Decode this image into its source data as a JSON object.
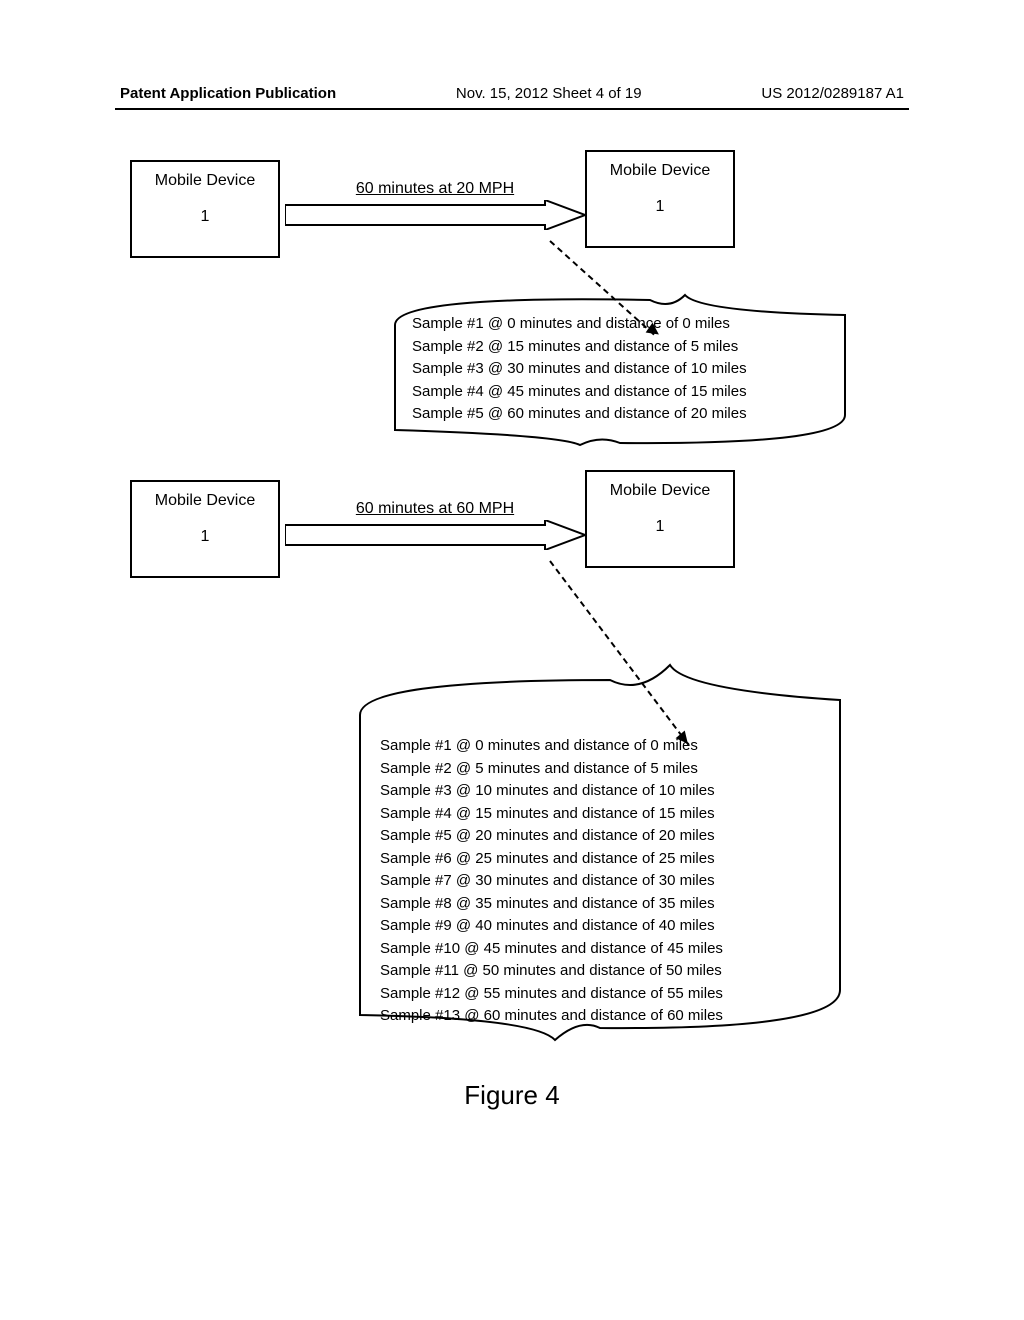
{
  "header": {
    "left": "Patent Application Publication",
    "center": "Nov. 15, 2012  Sheet 4 of 19",
    "right": "US 2012/0289187 A1"
  },
  "section1": {
    "box_left_label": "Mobile Device",
    "box_left_number": "1",
    "box_right_label": "Mobile Device",
    "box_right_number": "1",
    "arrow_label": "60 minutes at 20 MPH",
    "samples": [
      "Sample #1 @ 0 minutes and distance of 0 miles",
      "Sample #2 @ 15 minutes and distance of 5 miles",
      "Sample #3 @ 30 minutes and distance of 10 miles",
      "Sample #4 @ 45 minutes and distance of 15 miles",
      "Sample #5 @ 60 minutes and distance of 20 miles"
    ]
  },
  "section2": {
    "box_left_label": "Mobile Device",
    "box_left_number": "1",
    "box_right_label": "Mobile Device",
    "box_right_number": "1",
    "arrow_label": "60 minutes at 60 MPH",
    "samples": [
      "Sample #1 @ 0 minutes and distance of 0 miles",
      "Sample #2 @ 5 minutes and distance of 5 miles",
      "Sample #3 @ 10 minutes and distance of 10 miles",
      "Sample #4 @ 15 minutes and distance of 15 miles",
      "Sample #5 @ 20 minutes and distance of 20 miles",
      "Sample #6 @ 25 minutes and distance of 25 miles",
      "Sample #7 @ 30 minutes and distance of 30 miles",
      "Sample #8 @ 35 minutes and distance of 35 miles",
      "Sample #9 @ 40 minutes and distance of 40 miles",
      "Sample #10 @ 45 minutes and distance of 45 miles",
      "Sample #11 @ 50 minutes and distance of 50 miles",
      "Sample #12 @ 55 minutes and distance of 55 miles",
      "Sample #13 @ 60 minutes and distance of 60 miles"
    ]
  },
  "figure_label": "Figure 4"
}
